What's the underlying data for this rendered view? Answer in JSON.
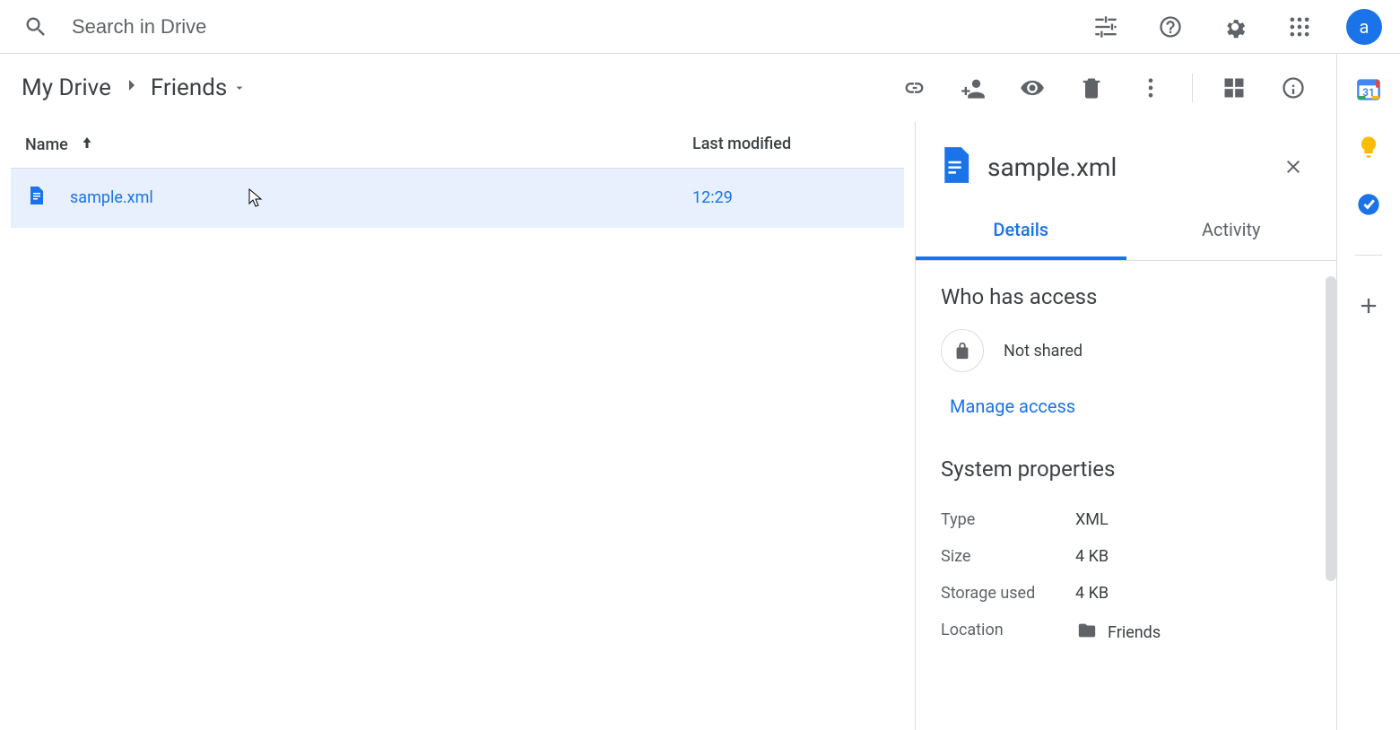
{
  "search": {
    "placeholder": "Search in Drive"
  },
  "avatar": {
    "letter": "a"
  },
  "breadcrumb": {
    "root": "My Drive",
    "current": "Friends"
  },
  "columns": {
    "name": "Name",
    "modified": "Last modified"
  },
  "files": [
    {
      "name": "sample.xml",
      "modified": "12:29"
    }
  ],
  "panel": {
    "title": "sample.xml",
    "tabs": {
      "details": "Details",
      "activity": "Activity"
    },
    "access": {
      "heading": "Who has access",
      "status": "Not shared",
      "manage": "Manage access"
    },
    "props": {
      "heading": "System properties",
      "type_label": "Type",
      "type_value": "XML",
      "size_label": "Size",
      "size_value": "4 KB",
      "storage_label": "Storage used",
      "storage_value": "4 KB",
      "location_label": "Location",
      "location_value": "Friends"
    }
  }
}
